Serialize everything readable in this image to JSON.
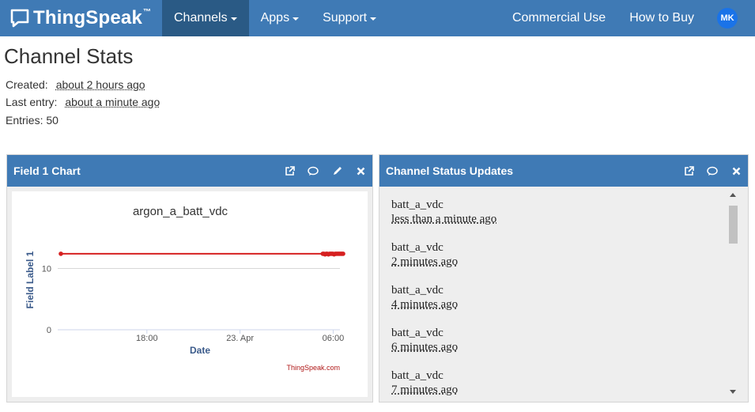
{
  "nav": {
    "brand": "ThingSpeak",
    "brand_tm": "™",
    "items": [
      {
        "label": "Channels",
        "active": true
      },
      {
        "label": "Apps"
      },
      {
        "label": "Support"
      }
    ],
    "right": [
      {
        "label": "Commercial Use"
      },
      {
        "label": "How to Buy"
      }
    ],
    "avatar": "MK"
  },
  "stats": {
    "title": "Channel Stats",
    "created_label": "Created:",
    "created_value": "about 2 hours ago",
    "last_entry_label": "Last entry:",
    "last_entry_value": "about a minute ago",
    "entries_label": "Entries:",
    "entries_value": "50"
  },
  "field_panel": {
    "title": "Field 1 Chart"
  },
  "status_panel": {
    "title": "Channel Status Updates",
    "items": [
      {
        "name": "batt_a_vdc",
        "time": "less than a minute ago"
      },
      {
        "name": "batt_a_vdc",
        "time": "2 minutes ago"
      },
      {
        "name": "batt_a_vdc",
        "time": "4 minutes ago"
      },
      {
        "name": "batt_a_vdc",
        "time": "6 minutes ago"
      },
      {
        "name": "batt_a_vdc",
        "time": "7 minutes ago"
      }
    ]
  },
  "chart_data": {
    "type": "line",
    "title": "argon_a_batt_vdc",
    "xlabel": "Date",
    "ylabel": "Field Label 1",
    "credit": "ThingSpeak.com",
    "x_ticks": [
      "18:00",
      "23. Apr",
      "06:00"
    ],
    "y_ticks": [
      "0",
      "10"
    ],
    "ylim": [
      0,
      20
    ],
    "series": [
      {
        "color": "#d62020",
        "x": [
          0,
          0.928,
          0.932,
          0.936,
          0.94,
          0.944,
          0.948,
          0.952,
          0.956,
          0.96,
          0.964,
          0.968,
          0.972,
          0.976,
          0.98,
          0.984,
          0.988,
          0.992,
          0.996,
          1.0
        ],
        "values": [
          12.4,
          12.4,
          12.4,
          12.3,
          12.4,
          12.4,
          12.3,
          12.4,
          12.4,
          12.4,
          12.4,
          12.3,
          12.4,
          12.4,
          12.4,
          12.4,
          12.4,
          12.4,
          12.4,
          12.4
        ]
      }
    ]
  },
  "colors": {
    "nav": "#3f7ab5",
    "nav_active": "#2a5a85",
    "series": "#d62020"
  }
}
